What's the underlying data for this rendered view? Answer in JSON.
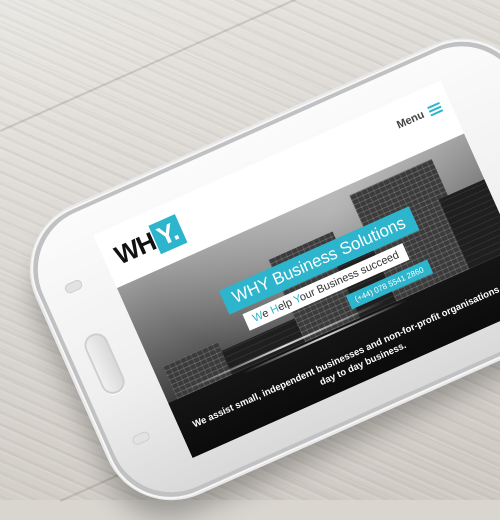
{
  "header": {
    "logo_text": "WH",
    "logo_accent": "Y.",
    "menu_label": "Menu",
    "menu_icon": "hamburger-icon"
  },
  "hero": {
    "title": "WHY Business Solutions",
    "subtitle_parts": [
      "W",
      "e ",
      "H",
      "elp ",
      "Y",
      "our Business succeed"
    ],
    "phone": "(+44) 078 5541 2860",
    "tagline_line1": "We assist small, independent businesses and non-for-profit organisations with the",
    "tagline_line2": "day to day business."
  },
  "colors": {
    "accent": "#2cb5cc",
    "logo_text": "#111111",
    "phone_body": "#f4f4f4"
  }
}
